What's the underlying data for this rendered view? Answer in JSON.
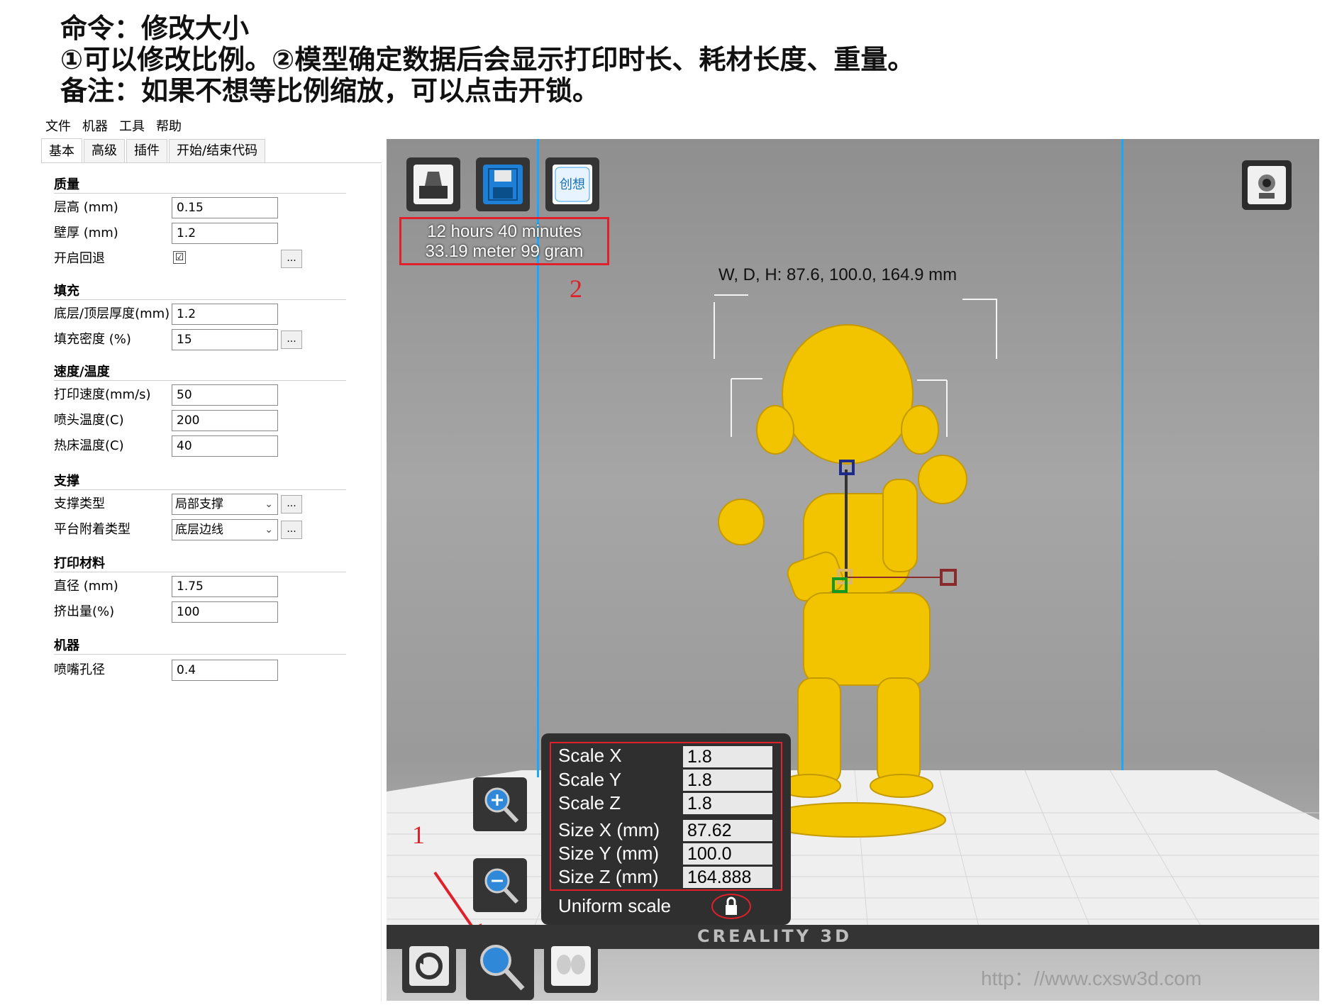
{
  "heading": {
    "line1": "命令：修改大小",
    "line2": "①可以修改比例。②模型确定数据后会显示打印时长、耗材长度、重量。",
    "line3": "备注：如果不想等比例缩放，可以点击开锁。"
  },
  "menu": [
    "文件",
    "机器",
    "工具",
    "帮助"
  ],
  "tabs": [
    "基本",
    "高级",
    "插件",
    "开始/结束代码"
  ],
  "sections": {
    "quality": {
      "title": "质量",
      "layer_height": {
        "label": "层高 (mm)",
        "value": "0.15"
      },
      "shell_thickness": {
        "label": "壁厚 (mm)",
        "value": "1.2"
      },
      "retraction": {
        "label": "开启回退",
        "checked": "☑"
      }
    },
    "fill": {
      "title": "填充",
      "bottom_top": {
        "label": "底层/顶层厚度(mm)",
        "value": "1.2"
      },
      "density": {
        "label": "填充密度 (%)",
        "value": "15"
      }
    },
    "speed": {
      "title": "速度/温度",
      "print_speed": {
        "label": "打印速度(mm/s)",
        "value": "50"
      },
      "nozzle_temp": {
        "label": "喷头温度(C)",
        "value": "200"
      },
      "bed_temp": {
        "label": "热床温度(C)",
        "value": "40"
      }
    },
    "support": {
      "title": "支撑",
      "support_type": {
        "label": "支撑类型",
        "value": "局部支撑"
      },
      "adhesion": {
        "label": "平台附着类型",
        "value": "底层边线"
      }
    },
    "filament": {
      "title": "打印材料",
      "diameter": {
        "label": "直径 (mm)",
        "value": "1.75"
      },
      "flow": {
        "label": "挤出量(%)",
        "value": "100"
      }
    },
    "machine": {
      "title": "机器",
      "nozzle": {
        "label": "喷嘴孔径",
        "value": "0.4"
      }
    },
    "more_button": "..."
  },
  "viewport": {
    "print_time": "12 hours 40 minutes",
    "material": "33.19 meter 99 gram",
    "dimensions": "W, D, H: 87.6, 100.0, 164.9 mm",
    "annotation_1": "1",
    "annotation_2": "2",
    "scale": {
      "x": {
        "label": "Scale X",
        "value": "1.8"
      },
      "y": {
        "label": "Scale Y",
        "value": "1.8"
      },
      "z": {
        "label": "Scale Z",
        "value": "1.8"
      },
      "size_x": {
        "label": "Size X (mm)",
        "value": "87.62"
      },
      "size_y": {
        "label": "Size Y (mm)",
        "value": "100.0"
      },
      "size_z": {
        "label": "Size Z (mm)",
        "value": "164.888"
      },
      "uniform": "Uniform scale"
    },
    "bed_logo": "CREALITY 3D",
    "watermark": "http：//www.cxsw3d.com"
  },
  "colors": {
    "model": "#f2c400",
    "accent_red": "#e0202a",
    "guide_blue": "#1aa7ff"
  },
  "icons": [
    "load-icon",
    "save-icon",
    "creality-logo-icon",
    "camera-view-icon",
    "zoom-in-icon",
    "zoom-out-icon",
    "rotate-icon",
    "scale-icon",
    "mirror-icon",
    "lock-icon"
  ]
}
